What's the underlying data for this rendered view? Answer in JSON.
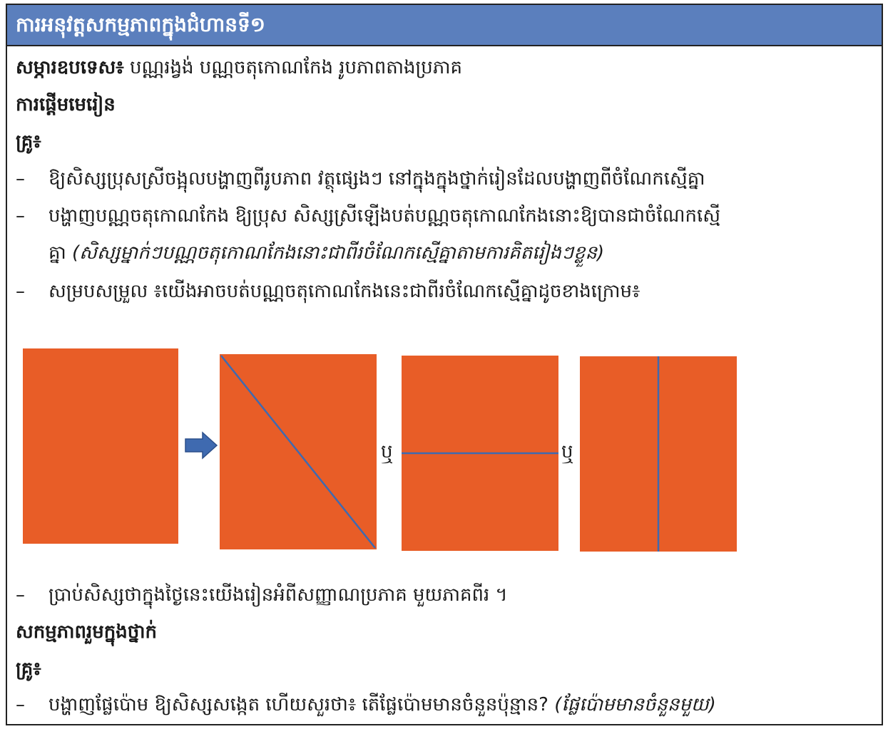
{
  "header": {
    "title": "ការអនុវត្តសកម្មភាពក្នុងជំហានទី១"
  },
  "materials": {
    "label": "សម្ភារឧបទេស៖",
    "text": "  បណ្ណរង្វង់ បណ្ណចតុកោណកែង រូបភាពតាងប្រភាគ"
  },
  "section_start": {
    "title": "ការផ្ដើមមេរៀន"
  },
  "teacher1": {
    "label": "គ្រូ៖"
  },
  "bullets1": [
    {
      "dash": "–",
      "text": "ឱ្យសិស្សប្រុសស្រីចង្អុលបង្ហាញពីរូបភាព វត្ថុផ្សេងៗ នៅក្នុងក្នុងថ្នាក់រៀនដែលបង្ហាញពីចំណែកស្មើគ្នា"
    },
    {
      "dash": "–",
      "text": "បង្ហាញបណ្ណចតុកោណកែង  ឱ្យប្រុស  សិស្សស្រីឡើងបត់បណ្ណចតុកោណកែងនោះឱ្យបានជាចំណែកស្មើ"
    },
    {
      "text": "គ្នា ",
      "note": "(សិស្សម្នាក់ៗបណ្ណចតុកោណកែងនោះជាពីរចំណែកស្មើគ្នាតាមការគិតរៀងៗខ្លួន)"
    },
    {
      "dash": "–",
      "text": "សម្របសម្រួល ៖យើងអាចបត់បណ្ណចតុកោណកែងនេះជាពីរចំណែកស្មើគ្នាដូចខាងក្រោម៖"
    }
  ],
  "figure": {
    "or_left": "ឬ",
    "or_right": "ឬ",
    "sheet_color": "#e85d27",
    "fold_line_color": "#3f6ab0",
    "arrow_color": "#3f6ab0",
    "icon": "arrow-right-icon"
  },
  "bullet_after": {
    "dash": "–",
    "text": "ប្រាប់សិស្សថាក្នុងថ្ងៃនេះយើងរៀនអំពីសញ្ញាណប្រភាគ  មួយភាគពីរ ។"
  },
  "section_class": {
    "title": "សកម្មភាពរួមក្នុងថ្នាក់"
  },
  "teacher2": {
    "label": "គ្រូ៖"
  },
  "bullet_last": {
    "dash": "–",
    "text": "បង្ហាញផ្លែប៉ោម ឱ្យសិស្សសង្កេត ហើយសួរថា៖ តើផ្លែប៉ោមមានចំនួនប៉ុន្មាន? ",
    "note": "(ផ្លែប៉ោមមានចំនួនមួយ)"
  },
  "colors": {
    "header_bg": "#5b7fbd",
    "border": "#222222"
  }
}
